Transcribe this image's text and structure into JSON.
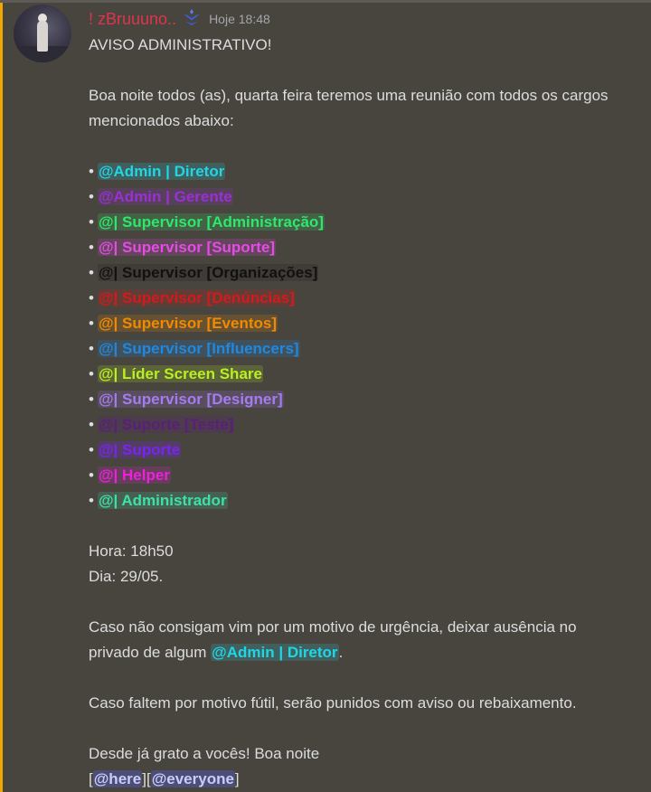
{
  "message": {
    "username": "! zBruuuno..",
    "username_color": "#e0334d",
    "badge_icon": "hypesquad-badge-icon",
    "timestamp": "Hoje 18:48",
    "title": "AVISO ADMINISTRATIVO!",
    "intro_line1": "Boa noite todos (as), quarta feira teremos uma reunião com todos os cargos",
    "intro_line2": "mencionados abaixo:",
    "bullet": "•",
    "roles": [
      {
        "label": "@Admin | Diretor",
        "color": "#20d6e6",
        "bg": "rgba(32,214,230,0.18)"
      },
      {
        "label": "@Admin | Gerente",
        "color": "#9b2fd6",
        "bg": "rgba(155,47,214,0.18)"
      },
      {
        "label": "@| Supervisor [Administração]",
        "color": "#2ee86c",
        "bg": "rgba(46,232,108,0.18)"
      },
      {
        "label": "@| Supervisor [Suporte]",
        "color": "#e64be6",
        "bg": "rgba(230,75,230,0.18)"
      },
      {
        "label": "@| Supervisor [Organizações]",
        "color": "#111111",
        "bg": "rgba(20,20,20,0.18)"
      },
      {
        "label": "@| Supervisor [Denúncias]",
        "color": "#d41a1a",
        "bg": "rgba(212,26,26,0.18)"
      },
      {
        "label": "@| Supervisor [Eventos]",
        "color": "#f08a00",
        "bg": "rgba(240,138,0,0.18)"
      },
      {
        "label": "@| Supervisor [Influencers]",
        "color": "#1f88e0",
        "bg": "rgba(31,136,224,0.18)"
      },
      {
        "label": "@| Líder Screen Share",
        "color": "#b9f01f",
        "bg": "rgba(185,240,31,0.18)"
      },
      {
        "label": "@| Supervisor [Designer]",
        "color": "#a57cf0",
        "bg": "rgba(165,124,240,0.18)"
      },
      {
        "label": "@| Suporte [Teste]",
        "color": "#5a1f7a",
        "bg": "rgba(90,31,122,0.22)"
      },
      {
        "label": "@| Suporte",
        "color": "#7a24f0",
        "bg": "rgba(122,36,240,0.22)"
      },
      {
        "label": "@| Helper",
        "color": "#f01ee0",
        "bg": "rgba(240,30,224,0.18)"
      },
      {
        "label": "@| Administrador",
        "color": "#3fe0a8",
        "bg": "rgba(63,224,168,0.18)"
      }
    ],
    "hora": "Hora: 18h50",
    "dia": "Dia: 29/05.",
    "absence_line1": "Caso não consigam vim por um motivo de urgência, deixar ausência no",
    "absence_line2_pre": "privado de algum",
    "absence_mention": "@Admin | Diretor",
    "absence_mention_color": "#20d6e6",
    "absence_line2_post": ".",
    "punish_line": "Caso faltem por motivo fútil, serão punidos com aviso ou rebaixamento.",
    "thanks_line": "Desde já grato a vocês! Boa noite",
    "bracket_open": "[",
    "here_mention": "@here",
    "bracket_mid": "][",
    "everyone_mention": "@everyone",
    "bracket_close": "]",
    "everyone_color": "#c9cdfb",
    "everyone_bg": "rgba(88,101,242,0.3)",
    "accent_color": "#f0a800"
  }
}
